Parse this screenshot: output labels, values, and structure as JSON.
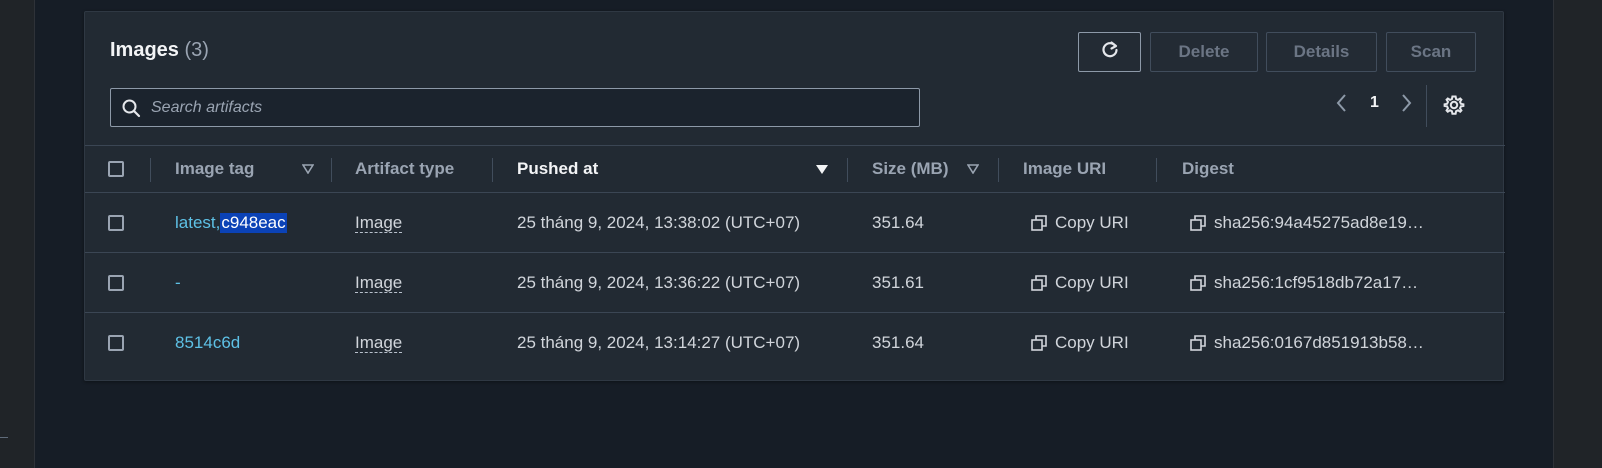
{
  "panel": {
    "title": "Images",
    "count": "(3)"
  },
  "actions": {
    "delete_label": "Delete",
    "details_label": "Details",
    "scan_label": "Scan"
  },
  "search": {
    "placeholder": "Search artifacts",
    "value": ""
  },
  "pagination": {
    "current_page": "1"
  },
  "columns": {
    "image_tag": "Image tag",
    "artifact_type": "Artifact type",
    "pushed_at": "Pushed at",
    "size": "Size (MB)",
    "image_uri": "Image URI",
    "digest": "Digest"
  },
  "rows": [
    {
      "tag_prefix": "latest, ",
      "tag_selected": "c948eac",
      "artifact_type": "Image",
      "pushed_at": "25 tháng 9, 2024, 13:38:02 (UTC+07)",
      "size": "351.64",
      "copy_uri": "Copy URI",
      "digest": "sha256:94a45275ad8e19…"
    },
    {
      "tag_prefix": "-",
      "tag_selected": "",
      "artifact_type": "Image",
      "pushed_at": "25 tháng 9, 2024, 13:36:22 (UTC+07)",
      "size": "351.61",
      "copy_uri": "Copy URI",
      "digest": "sha256:1cf9518db72a17…"
    },
    {
      "tag_prefix": "8514c6d",
      "tag_selected": "",
      "artifact_type": "Image",
      "pushed_at": "25 tháng 9, 2024, 13:14:27 (UTC+07)",
      "size": "351.64",
      "copy_uri": "Copy URI",
      "digest": "sha256:0167d851913b58…"
    }
  ],
  "icons": {
    "refresh": "refresh-icon",
    "search": "search-icon",
    "prev": "chevron-left-icon",
    "next": "chevron-right-icon",
    "settings": "gear-icon",
    "copy": "copy-icon"
  },
  "colors": {
    "background": "#161d26",
    "panel": "#222a33",
    "link": "#5ec1e6",
    "selection": "#0b42b6"
  }
}
